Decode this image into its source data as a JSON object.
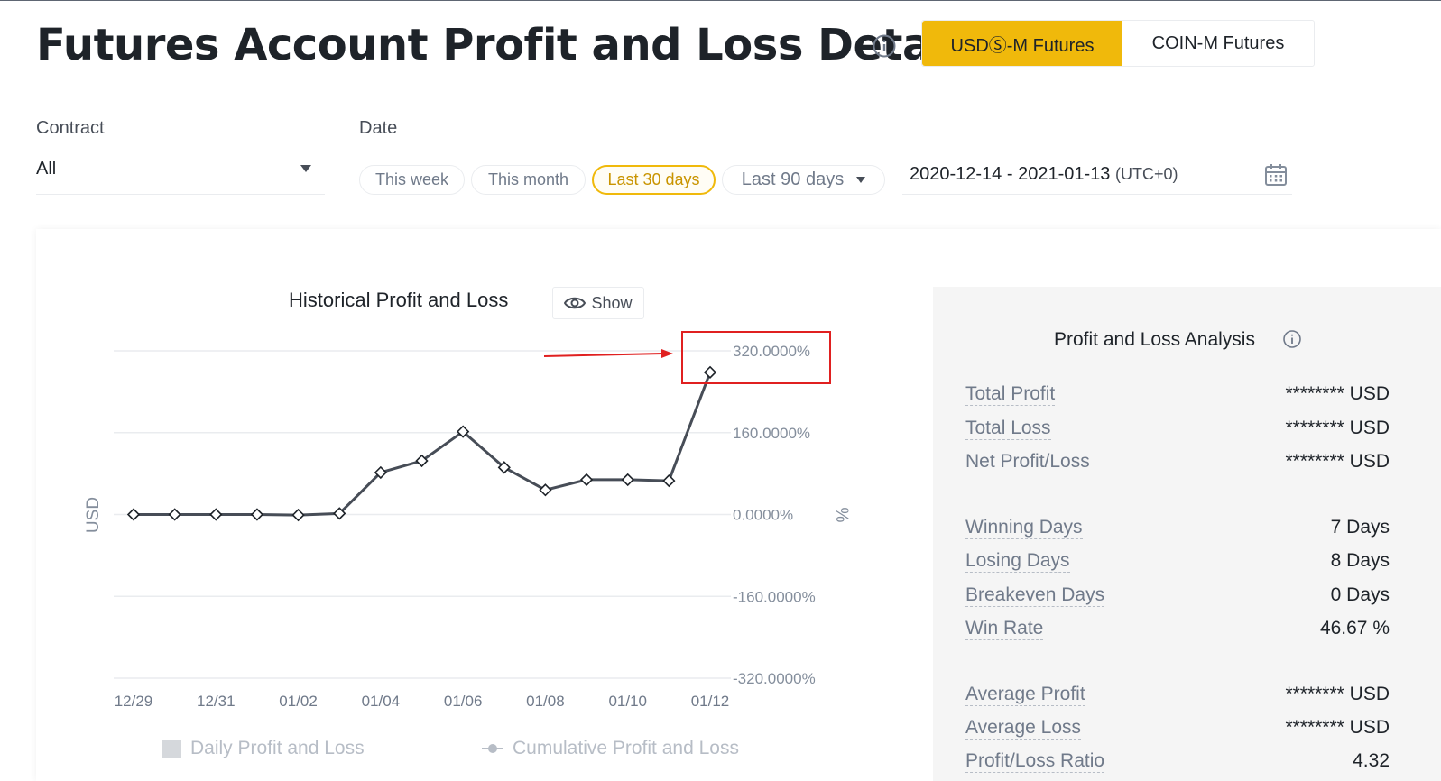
{
  "header": {
    "title": "Futures Account Profit and Loss Details",
    "tabs": [
      {
        "label": "USDⓈ-M Futures",
        "active": true
      },
      {
        "label": "COIN-M Futures",
        "active": false
      }
    ]
  },
  "filters": {
    "contract_label": "Contract",
    "contract_value": "All",
    "date_label": "Date",
    "presets": [
      {
        "label": "This week",
        "active": false
      },
      {
        "label": "This month",
        "active": false
      },
      {
        "label": "Last 30 days",
        "active": true
      },
      {
        "label": "Last 90 days",
        "active": false
      }
    ],
    "date_range": "2020-12-14 - 2021-01-13",
    "timezone": "(UTC+0)"
  },
  "chart": {
    "title": "Historical Profit and Loss",
    "show_label": "Show",
    "y_left_label": "USD",
    "y_right_label": "%",
    "legend": [
      "Daily Profit and Loss",
      "Cumulative Profit and Loss"
    ]
  },
  "chart_data": {
    "type": "line",
    "x": [
      "12/29",
      "12/30",
      "12/31",
      "01/01",
      "01/02",
      "01/03",
      "01/04",
      "01/05",
      "01/06",
      "01/07",
      "01/08",
      "01/09",
      "01/10",
      "01/11",
      "01/12"
    ],
    "x_tick_labels": [
      "12/29",
      "12/31",
      "01/02",
      "01/04",
      "01/06",
      "01/08",
      "01/10",
      "01/12"
    ],
    "y_tick_labels": [
      "320.0000%",
      "160.0000%",
      "0.0000%",
      "-160.0000%",
      "-320.0000%"
    ],
    "ylim": [
      -320,
      320
    ],
    "grid": true,
    "legend_position": "bottom",
    "series": [
      {
        "name": "Cumulative Profit and Loss",
        "values": [
          0,
          0,
          0,
          0,
          -1,
          2,
          82,
          105,
          162,
          92,
          48,
          68,
          68,
          66,
          278
        ]
      }
    ],
    "annotation": {
      "color": "#e02020",
      "target": "01/12"
    }
  },
  "analysis": {
    "title": "Profit and Loss Analysis",
    "rows": [
      {
        "label": "Total Profit",
        "value": "******** USD"
      },
      {
        "label": "Total Loss",
        "value": "******** USD"
      },
      {
        "label": "Net Profit/Loss",
        "value": "******** USD"
      },
      {
        "label": "Winning Days",
        "value": "7 Days"
      },
      {
        "label": "Losing Days",
        "value": "8 Days"
      },
      {
        "label": "Breakeven Days",
        "value": "0 Days"
      },
      {
        "label": "Win Rate",
        "value": "46.67 %"
      },
      {
        "label": "Average Profit",
        "value": "******** USD"
      },
      {
        "label": "Average Loss",
        "value": "******** USD"
      },
      {
        "label": "Profit/Loss Ratio",
        "value": "4.32"
      }
    ]
  },
  "colors": {
    "accent": "#f0b90b",
    "annotation": "#e02020",
    "line": "#474d57"
  }
}
